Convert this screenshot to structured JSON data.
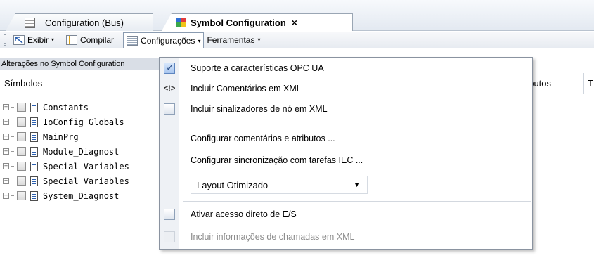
{
  "tabs": [
    {
      "label": "Configuration (Bus)",
      "active": false
    },
    {
      "label": "Symbol Configuration",
      "active": true,
      "close": "×"
    }
  ],
  "toolbar": {
    "view_label": "Exibir",
    "build_label": "Compilar",
    "settings_label": "Configurações",
    "tools_label": "Ferramentas",
    "caret": "▾"
  },
  "panel": {
    "subheader": "Alterações no Symbol Configuration",
    "col_symbols": "Símbolos",
    "col_attributes": "ributos",
    "col_next": "T"
  },
  "tree": [
    {
      "label": "Constants"
    },
    {
      "label": "IoConfig_Globals"
    },
    {
      "label": "MainPrg"
    },
    {
      "label": "Module_Diagnost"
    },
    {
      "label": "Special_Variables"
    },
    {
      "label": "Special_Variables"
    },
    {
      "label": "System_Diagnost"
    }
  ],
  "menu": {
    "items": [
      {
        "label": "Suporte a características OPC UA",
        "state": "checked"
      },
      {
        "label": "Incluir Comentários em XML",
        "state": "icon",
        "icon_text": "<!>"
      },
      {
        "label": "Incluir sinalizadores de nó em XML",
        "state": "unchecked"
      },
      {
        "label": "Configurar comentários e atributos ...",
        "state": "none"
      },
      {
        "label": "Configurar sincronização com tarefas IEC ...",
        "state": "none"
      },
      {
        "label": "Ativar acesso direto de E/S",
        "state": "unchecked"
      },
      {
        "label": "Incluir informações de chamadas em XML",
        "state": "disabled"
      }
    ],
    "layout_combo": {
      "value": "Layout Otimizado",
      "arrow": "▼"
    }
  },
  "colors": {
    "accent": "#5e86c0",
    "menu_border": "#8a93a0",
    "disabled_text": "#8c8c8c"
  }
}
